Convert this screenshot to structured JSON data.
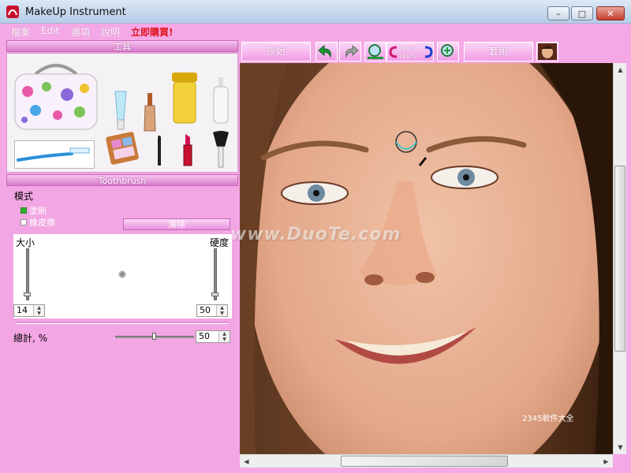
{
  "window": {
    "title": "MakeUp Instrument",
    "min": "–",
    "max": "□",
    "close": "✕"
  },
  "menu": [
    {
      "label": "檔案"
    },
    {
      "label": "Edit"
    },
    {
      "label": "選項"
    },
    {
      "label": "說明"
    }
  ],
  "menu_buy": "立即購買!",
  "tools_header": "工具",
  "tools": [
    "cosmetic-bag",
    "concealer-tube",
    "foundation-bottle",
    "cream-jar",
    "lotion-bottle",
    "toothbrush",
    "eyeshadow-palette",
    "eyeliner",
    "lipstick",
    "powder-brush"
  ],
  "brush_header": "Toothbrush",
  "mode_label": "模式",
  "mode_options": [
    "塗刷",
    "橡皮擦"
  ],
  "mode_selected": 0,
  "clear_button": "清除",
  "size_label": "大小",
  "hardness_label": "硬度",
  "size_value": "14",
  "hardness_value": "50",
  "total_label": "總計, %",
  "total_value": "50",
  "toolbar": {
    "original": "原始",
    "apply": "套用",
    "zoom_in": "200%",
    "zoom_out": "100%"
  },
  "watermark": "www.DuoTe.com",
  "corner_logo": "2345軟件大全"
}
